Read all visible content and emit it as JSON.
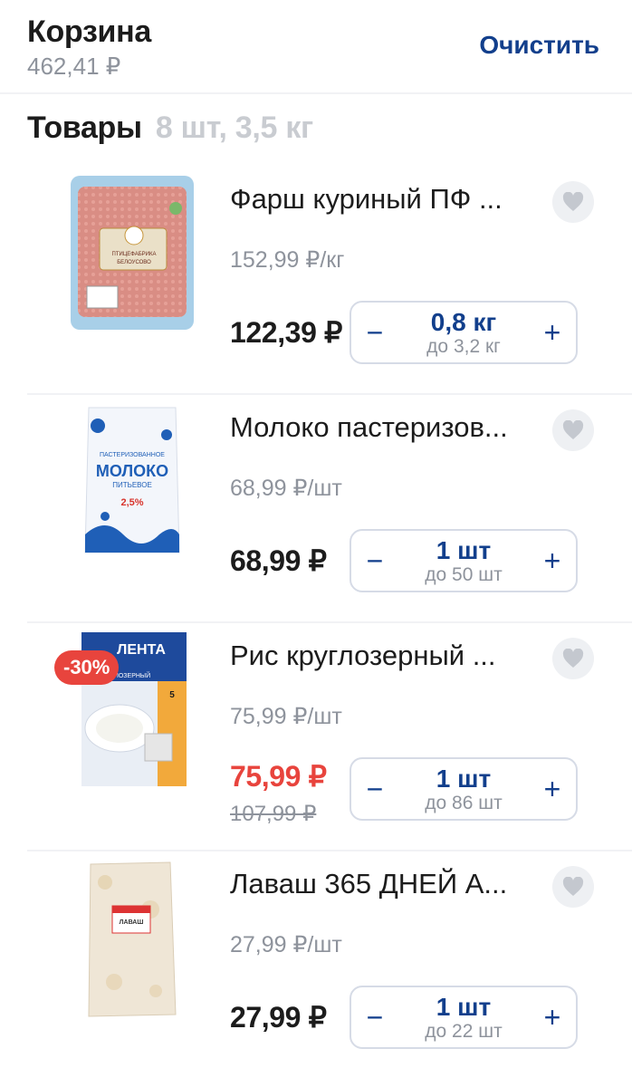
{
  "header": {
    "title": "Корзина",
    "total": "462,41 ₽",
    "clear_label": "Очистить"
  },
  "section": {
    "title": "Товары",
    "summary": "8 шт, 3,5 кг"
  },
  "items": [
    {
      "name": "Фарш куриный ПФ ...",
      "unit_price": "152,99 ₽/кг",
      "price": "122,39 ₽",
      "qty": "0,8 кг",
      "max": "до 3,2 кг",
      "minus": "−",
      "plus": "+"
    },
    {
      "name": "Молоко пастеризов...",
      "unit_price": "68,99 ₽/шт",
      "price": "68,99 ₽",
      "qty": "1 шт",
      "max": "до 50 шт",
      "minus": "−",
      "plus": "+"
    },
    {
      "name": "Рис круглозерный ...",
      "unit_price": "75,99 ₽/шт",
      "price": "75,99 ₽",
      "old_price": "107,99 ₽",
      "badge": "-30%",
      "qty": "1 шт",
      "max": "до 86 шт",
      "minus": "−",
      "plus": "+"
    },
    {
      "name": "Лаваш 365 ДНЕЙ А...",
      "unit_price": "27,99 ₽/шт",
      "price": "27,99 ₽",
      "qty": "1 шт",
      "max": "до 22 шт",
      "minus": "−",
      "plus": "+"
    }
  ],
  "package_text": {
    "mince": [
      "ПТИЦЕФАБРИКА",
      "БЕЛОУСОВО"
    ],
    "milk": [
      "ПАСТЕРИЗОВАННОЕ",
      "МОЛОКО",
      "ПИТЬЕВОЕ",
      "2,5%"
    ],
    "rice": [
      "ЛЕНТА",
      "КРУГЛОЗЕРНЫЙ",
      "5"
    ],
    "lavash": [
      "ЛАВАШ"
    ]
  },
  "colors": {
    "accent": "#123f8c",
    "sale": "#e8443d",
    "muted": "#8e939c"
  },
  "icons": {
    "favorite": "heart-icon",
    "minus": "minus-icon",
    "plus": "plus-icon"
  }
}
